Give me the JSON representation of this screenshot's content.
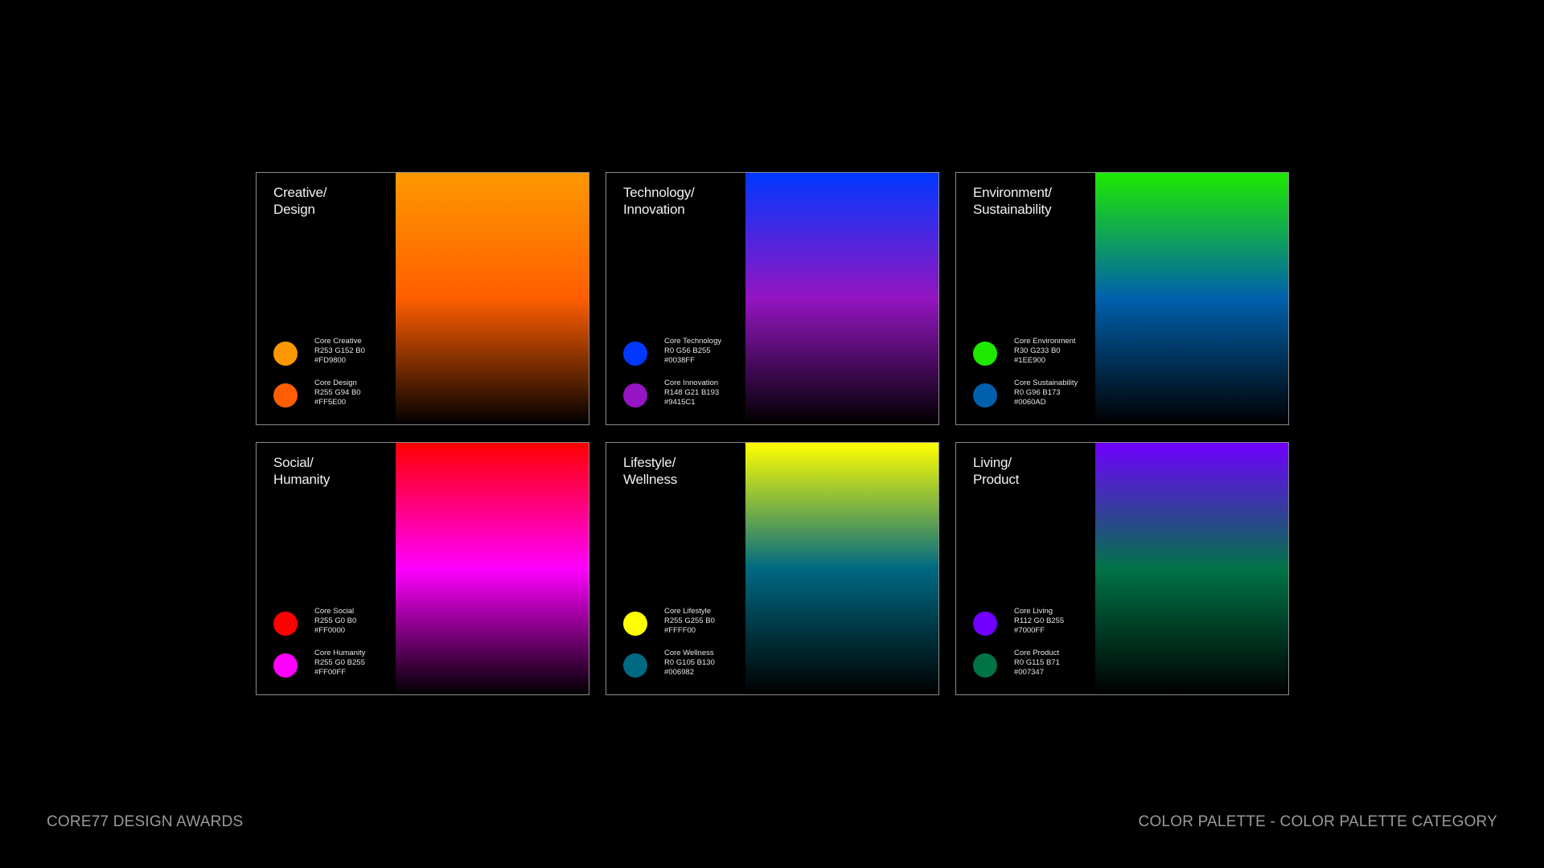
{
  "footer": {
    "left": "CORE77 DESIGN AWARDS",
    "right": "COLOR PALETTE - COLOR PALETTE CATEGORY"
  },
  "cards": [
    {
      "title": "Creative/\nDesign",
      "gradient": [
        "#FD9800",
        "#FF5E00",
        "#000000"
      ],
      "swatches": [
        {
          "name": "Core Creative",
          "rgb": "R253 G152 B0",
          "hex": "#FD9800"
        },
        {
          "name": "Core Design",
          "rgb": "R255 G94 B0",
          "hex": "#FF5E00"
        }
      ]
    },
    {
      "title": "Technology/\nInnovation",
      "gradient": [
        "#0038FF",
        "#9415C1",
        "#000000"
      ],
      "swatches": [
        {
          "name": "Core Technology",
          "rgb": "R0 G56 B255",
          "hex": "#0038FF"
        },
        {
          "name": "Core Innovation",
          "rgb": "R148 G21 B193",
          "hex": "#9415C1"
        }
      ]
    },
    {
      "title": "Environment/\nSustainability",
      "gradient": [
        "#1EE900",
        "#0060AD",
        "#000000"
      ],
      "swatches": [
        {
          "name": "Core Environment",
          "rgb": "R30 G233 B0",
          "hex": "#1EE900"
        },
        {
          "name": "Core Sustainability",
          "rgb": "R0 G96 B173",
          "hex": "#0060AD"
        }
      ]
    },
    {
      "title": "Social/\nHumanity",
      "gradient": [
        "#FF0000",
        "#FF00FF",
        "#000000"
      ],
      "swatches": [
        {
          "name": "Core Social",
          "rgb": "R255 G0 B0",
          "hex": "#FF0000"
        },
        {
          "name": "Core Humanity",
          "rgb": "R255 G0 B255",
          "hex": "#FF00FF"
        }
      ]
    },
    {
      "title": "Lifestyle/\nWellness",
      "gradient": [
        "#FFFF00",
        "#006982",
        "#000000"
      ],
      "swatches": [
        {
          "name": "Core Lifestyle",
          "rgb": "R255 G255 B0",
          "hex": "#FFFF00"
        },
        {
          "name": "Core Wellness",
          "rgb": "R0 G105 B130",
          "hex": "#006982"
        }
      ]
    },
    {
      "title": "Living/\nProduct",
      "gradient": [
        "#7000FF",
        "#007347",
        "#000000"
      ],
      "swatches": [
        {
          "name": "Core Living",
          "rgb": "R112 G0 B255",
          "hex": "#7000FF"
        },
        {
          "name": "Core Product",
          "rgb": "R0 G115 B71",
          "hex": "#007347"
        }
      ]
    }
  ]
}
